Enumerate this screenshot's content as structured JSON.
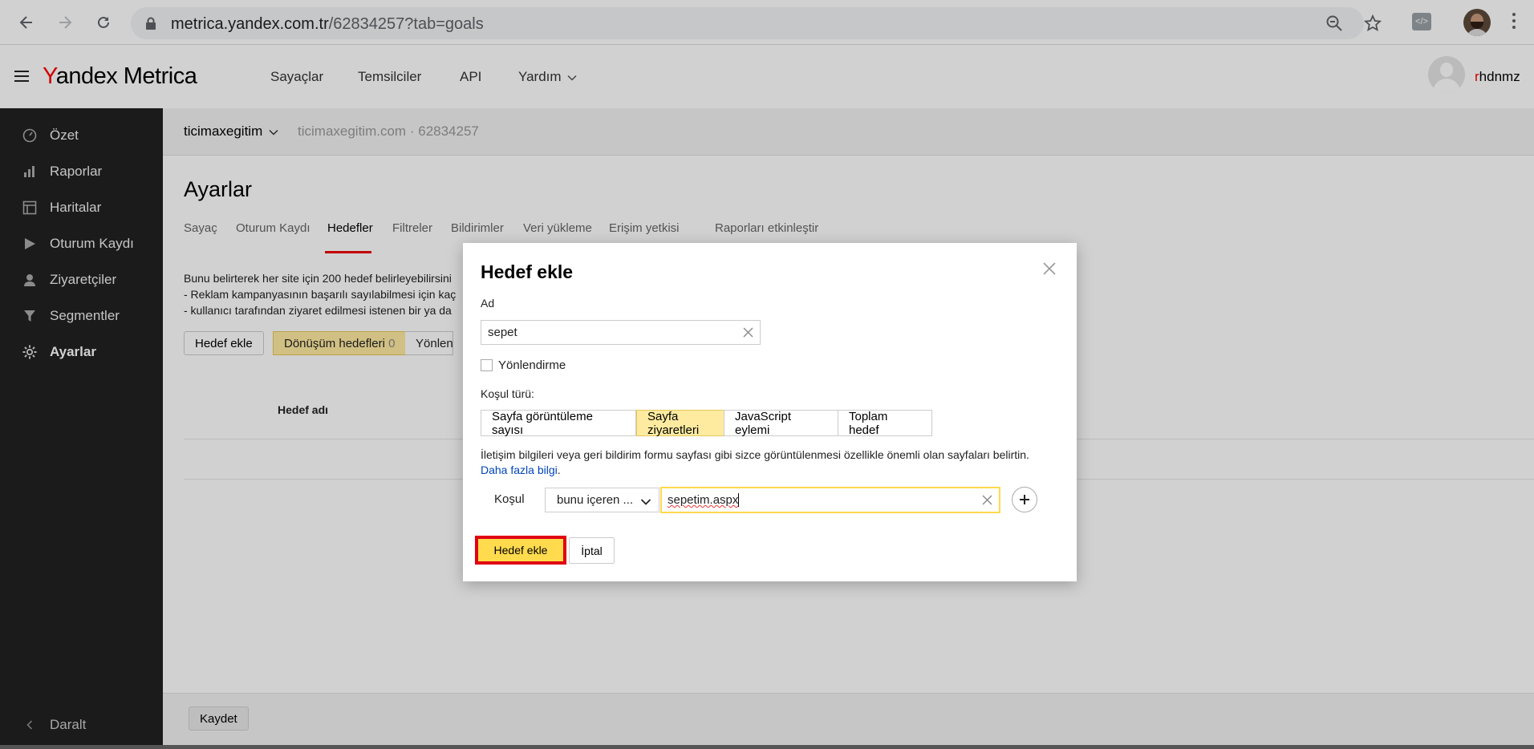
{
  "browser": {
    "url_host": "metrica.yandex.com.tr",
    "url_path": "/62834257?tab=goals"
  },
  "header": {
    "logo_y": "Y",
    "logo_rest": "andex Metrica",
    "nav": [
      "Sayaçlar",
      "Temsilciler",
      "API",
      "Yardım"
    ],
    "user_first": "r",
    "user_rest": "hdnmz"
  },
  "sidebar": {
    "items": [
      {
        "label": "Özet",
        "icon": "dashboard-icon"
      },
      {
        "label": "Raporlar",
        "icon": "bar-chart-icon"
      },
      {
        "label": "Haritalar",
        "icon": "map-icon"
      },
      {
        "label": "Oturum Kaydı",
        "icon": "play-icon"
      },
      {
        "label": "Ziyaretçiler",
        "icon": "user-icon"
      },
      {
        "label": "Segmentler",
        "icon": "filter-icon"
      },
      {
        "label": "Ayarlar",
        "icon": "gear-icon",
        "active": true
      }
    ],
    "collapse_label": "Daralt"
  },
  "counter": {
    "name": "ticimaxegitim",
    "site": "ticimaxegitim.com",
    "sep": "·",
    "id": "62834257"
  },
  "page": {
    "title": "Ayarlar",
    "tabs": [
      "Sayaç",
      "Oturum Kaydı",
      "Hedefler",
      "Filtreler",
      "Bildirimler",
      "Veri yükleme",
      "Erişim yetkisi",
      "Raporları etkinleştir"
    ],
    "info_line1": "Bunu belirterek her site için 200 hedef belirleyebilirsini",
    "info_line2": "-  Reklam kampanyasının başarılı sayılabilmesi için kaç",
    "info_line3": "-  kullanıcı tarafından ziyaret edilmesi istenen bir ya da",
    "add_goal_btn": "Hedef ekle",
    "conversion_goals": "Dönüşüm hedefleri",
    "conversion_count": "0",
    "redirect_partial": "Yönlendi",
    "table_header": "Hedef adı",
    "save_btn": "Kaydet"
  },
  "modal": {
    "title": "Hedef ekle",
    "name_label": "Ad",
    "name_value": "sepet",
    "redirect_label": "Yönlendirme",
    "condition_type_label": "Koşul türü:",
    "condition_types": [
      "Sayfa görüntüleme sayısı",
      "Sayfa ziyaretleri",
      "JavaScript eylemi",
      "Toplam hedef"
    ],
    "selected_type": "Sayfa ziyaretleri",
    "description": "İletişim bilgileri veya geri bildirim formu sayfası gibi sizce görüntülenmesi özellikle önemli olan sayfaları belirtin.",
    "more_info": "Daha fazla bilgi",
    "condition_label": "Koşul",
    "condition_operator": "bunu içeren ...",
    "condition_value": "sepetim.aspx",
    "submit_btn": "Hedef ekle",
    "cancel_btn": "İptal"
  },
  "colors": {
    "accent_yellow": "#ffdb4d",
    "selected_yellow": "#ffeba0",
    "highlight_red": "#e00012",
    "sidebar_bg": "#212121",
    "link_blue": "#0044bb"
  }
}
